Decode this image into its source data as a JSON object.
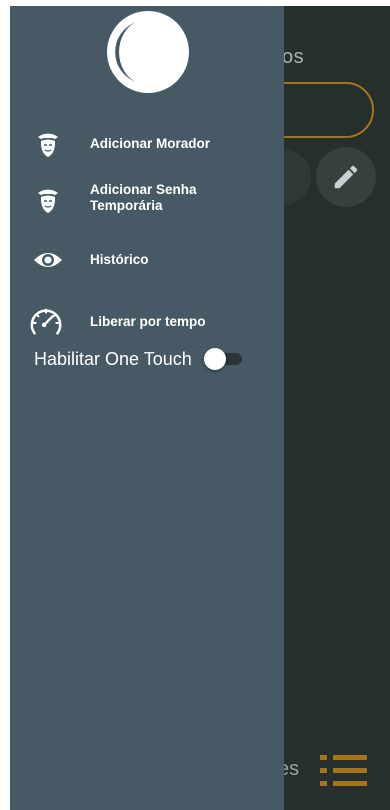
{
  "background_app": {
    "title_fragment": "os",
    "bottom_text_fragment": "es"
  },
  "drawer": {
    "menu": [
      {
        "label": "Adicionar Morador",
        "icon": "person-hat-icon"
      },
      {
        "label": "Adicionar Senha\nTemporária",
        "icon": "person-hat-icon"
      },
      {
        "label": "Histórico",
        "icon": "eye-icon"
      },
      {
        "label": "Liberar por tempo",
        "icon": "speedometer-icon"
      }
    ],
    "one_touch": {
      "label": "Habilitar One Touch",
      "enabled": false
    }
  },
  "colors": {
    "drawer_bg": "#465964",
    "app_bg": "#262f2c",
    "accent": "#a5751b"
  }
}
